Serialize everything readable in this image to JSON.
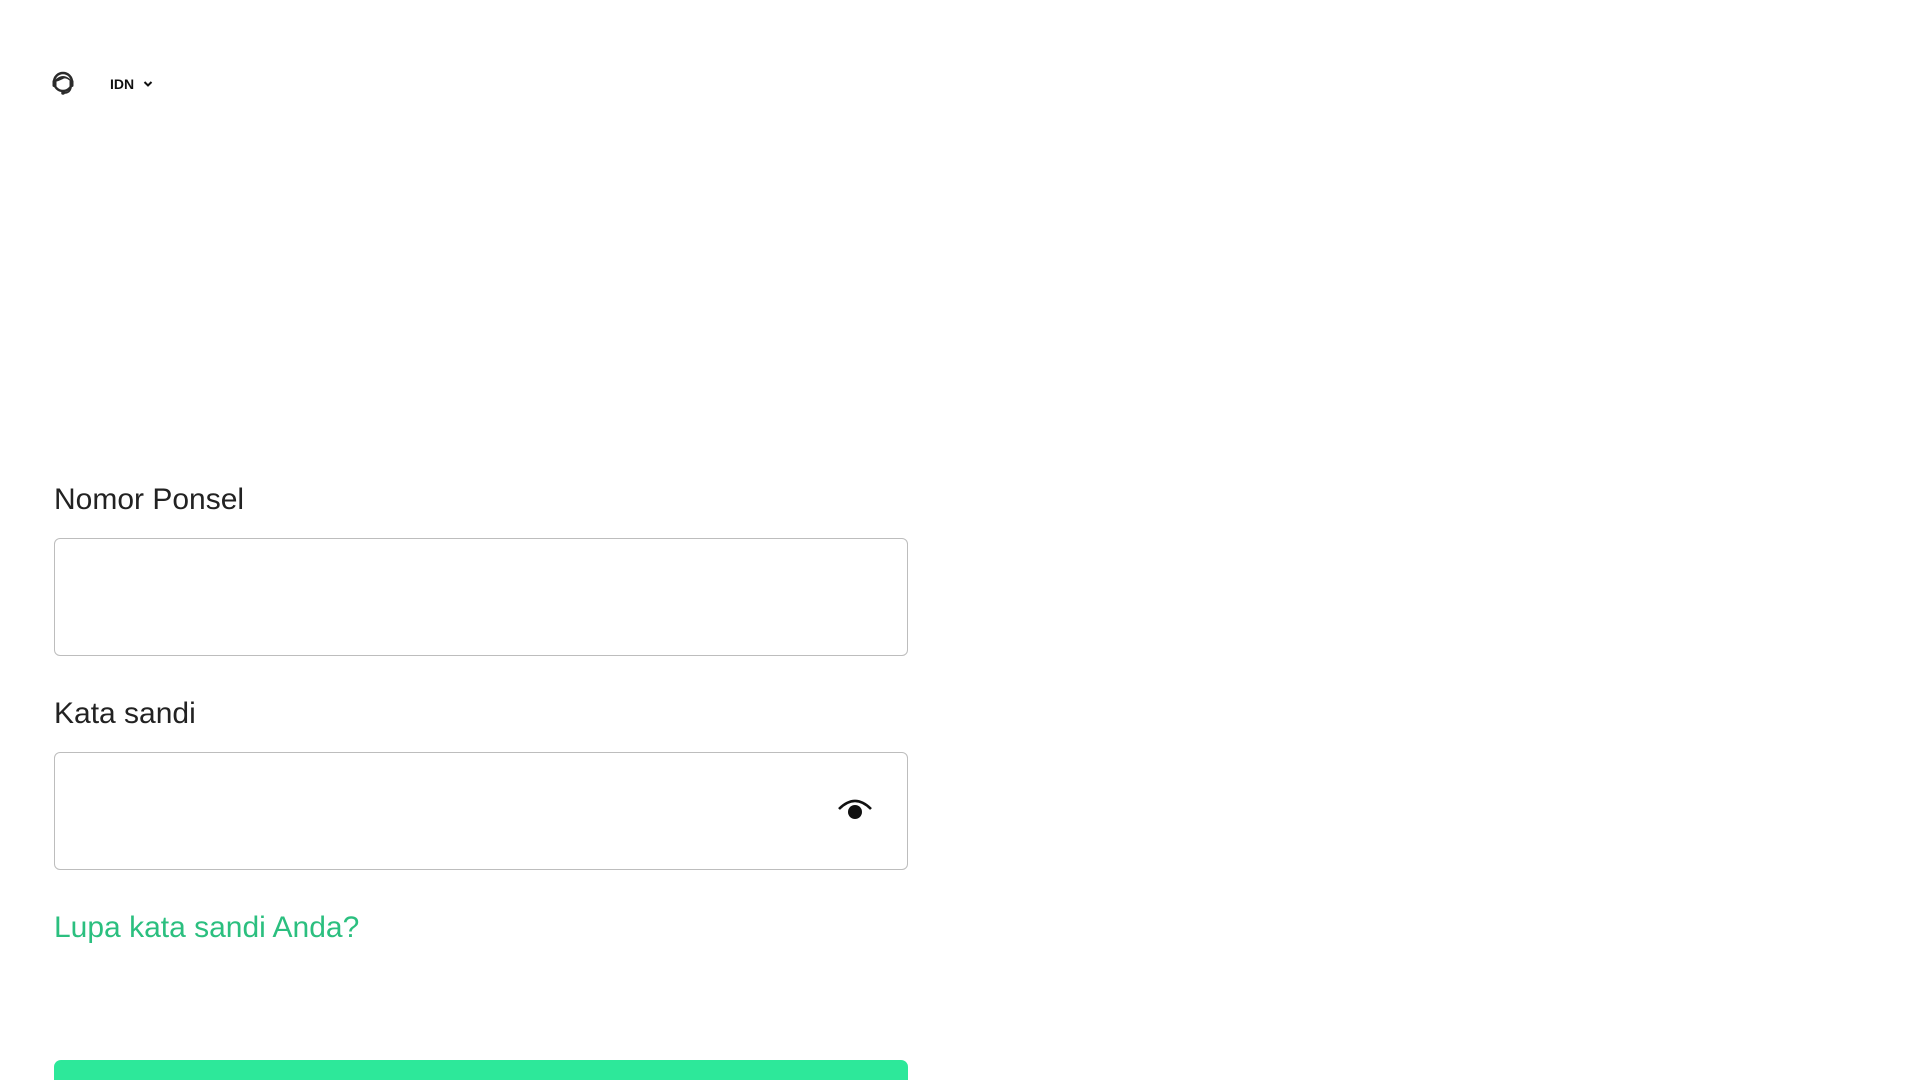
{
  "header": {
    "support_icon": "customer-support-icon",
    "language": {
      "selected": "IDN",
      "icon": "chevron-down-icon"
    }
  },
  "form": {
    "phone": {
      "label": "Nomor Ponsel",
      "value": "",
      "placeholder": ""
    },
    "password": {
      "label": "Kata sandi",
      "value": "",
      "placeholder": "",
      "toggle_icon": "eye-icon"
    },
    "forgot_link": "Lupa kata sandi Anda?",
    "submit_label": ""
  },
  "colors": {
    "accent_link": "#2bbf7f",
    "button": "#2de89a",
    "border": "#bdbdbd"
  }
}
